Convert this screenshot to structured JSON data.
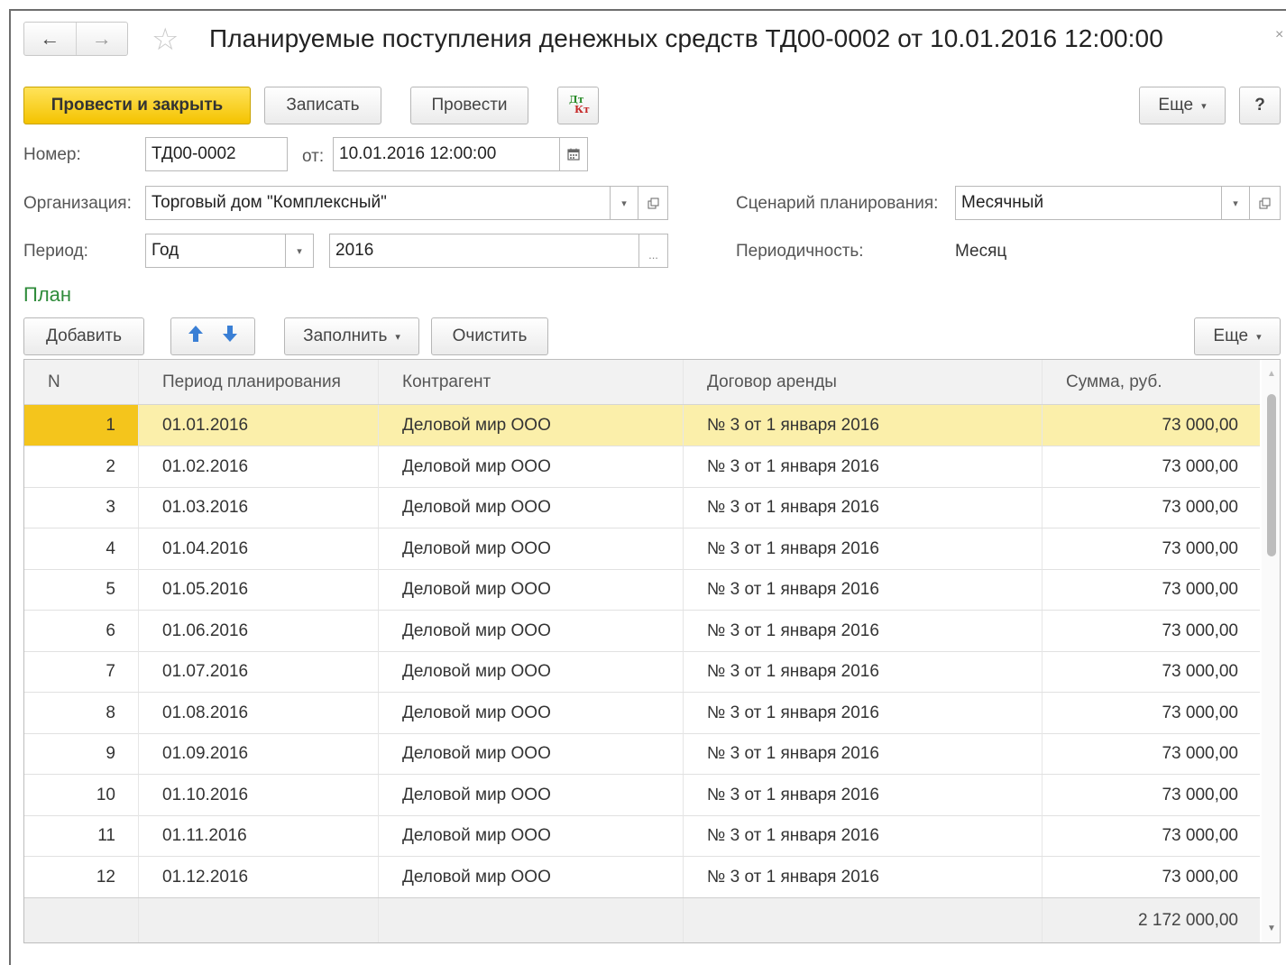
{
  "window": {
    "title": "Планируемые поступления денежных средств ТД00-0002 от 10.01.2016 12:00:00",
    "back_icon": "←",
    "forward_icon": "→",
    "star_icon": "☆",
    "close_icon": "×"
  },
  "toolbar": {
    "post_and_close": "Провести и закрыть",
    "save": "Записать",
    "post": "Провести",
    "dtkt_top": "Дт",
    "dtkt_bottom": "Кт",
    "more": "Еще",
    "help": "?"
  },
  "form": {
    "number_label": "Номер:",
    "number_value": "ТД00-0002",
    "date_label": "от:",
    "date_value": "10.01.2016 12:00:00",
    "org_label": "Организация:",
    "org_value": "Торговый дом \"Комплексный\"",
    "scenario_label": "Сценарий планирования:",
    "scenario_value": "Месячный",
    "period_label": "Период:",
    "period_type_value": "Год",
    "period_value": "2016",
    "period_select_icon": "...",
    "periodicity_label": "Периодичность:",
    "periodicity_value": "Месяц"
  },
  "plan": {
    "section_title": "План",
    "add": "Добавить",
    "fill": "Заполнить",
    "clear": "Очистить",
    "more": "Еще",
    "columns": [
      "N",
      "Период планирования",
      "Контрагент",
      "Договор аренды",
      "Сумма, руб."
    ],
    "rows": [
      {
        "n": "1",
        "period": "01.01.2016",
        "contractor": "Деловой мир ООО",
        "contract": "№ 3 от 1 января 2016",
        "sum": "73 000,00"
      },
      {
        "n": "2",
        "period": "01.02.2016",
        "contractor": "Деловой мир ООО",
        "contract": "№ 3 от 1 января 2016",
        "sum": "73 000,00"
      },
      {
        "n": "3",
        "period": "01.03.2016",
        "contractor": "Деловой мир ООО",
        "contract": "№ 3 от 1 января 2016",
        "sum": "73 000,00"
      },
      {
        "n": "4",
        "period": "01.04.2016",
        "contractor": "Деловой мир ООО",
        "contract": "№ 3 от 1 января 2016",
        "sum": "73 000,00"
      },
      {
        "n": "5",
        "period": "01.05.2016",
        "contractor": "Деловой мир ООО",
        "contract": "№ 3 от 1 января 2016",
        "sum": "73 000,00"
      },
      {
        "n": "6",
        "period": "01.06.2016",
        "contractor": "Деловой мир ООО",
        "contract": "№ 3 от 1 января 2016",
        "sum": "73 000,00"
      },
      {
        "n": "7",
        "period": "01.07.2016",
        "contractor": "Деловой мир ООО",
        "contract": "№ 3 от 1 января 2016",
        "sum": "73 000,00"
      },
      {
        "n": "8",
        "period": "01.08.2016",
        "contractor": "Деловой мир ООО",
        "contract": "№ 3 от 1 января 2016",
        "sum": "73 000,00"
      },
      {
        "n": "9",
        "period": "01.09.2016",
        "contractor": "Деловой мир ООО",
        "contract": "№ 3 от 1 января 2016",
        "sum": "73 000,00"
      },
      {
        "n": "10",
        "period": "01.10.2016",
        "contractor": "Деловой мир ООО",
        "contract": "№ 3 от 1 января 2016",
        "sum": "73 000,00"
      },
      {
        "n": "11",
        "period": "01.11.2016",
        "contractor": "Деловой мир ООО",
        "contract": "№ 3 от 1 января 2016",
        "sum": "73 000,00"
      },
      {
        "n": "12",
        "period": "01.12.2016",
        "contractor": "Деловой мир ООО",
        "contract": "№ 3 от 1 января 2016",
        "sum": "73 000,00"
      }
    ],
    "total": "2 172 000,00"
  },
  "colors": {
    "accent": "#f4c300",
    "selection": "#fbefaa",
    "section_title": "#2e8b3a",
    "arrow_icon": "#3a7fd5"
  }
}
